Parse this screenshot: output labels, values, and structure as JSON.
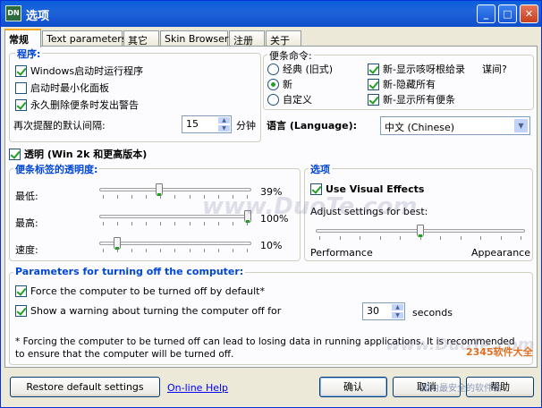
{
  "window": {
    "title": "选项",
    "icon_text": "DN"
  },
  "tabs": [
    {
      "label": "常规",
      "active": true
    },
    {
      "label": "Text parameters",
      "active": false
    },
    {
      "label": "其它",
      "active": false
    },
    {
      "label": "Skin Browser",
      "active": false
    },
    {
      "label": "注册",
      "active": false
    },
    {
      "label": "关于",
      "active": false
    }
  ],
  "program_group": {
    "legend": "程序:",
    "items": [
      {
        "label": "Windows启动时运行程序",
        "checked": true
      },
      {
        "label": "启动时最小化面板",
        "checked": false
      },
      {
        "label": "永久删除便条时发出警告",
        "checked": true
      }
    ],
    "reminder_label": "再次提醒的默认间隔:",
    "reminder_value": "15",
    "reminder_unit": "分钟"
  },
  "notes_cmd_group": {
    "legend": "便条命令:",
    "radios": [
      {
        "label": "经典 (旧式)",
        "checked": false
      },
      {
        "label": "新",
        "checked": true
      },
      {
        "label": "自定义",
        "checked": false
      }
    ],
    "checks": [
      {
        "label": "新-显示咳呀根给录",
        "checked": true
      },
      {
        "label": "新-隐藏所有",
        "checked": true
      },
      {
        "label": "新-显示所有便条",
        "checked": true
      }
    ],
    "query": "谋间?"
  },
  "language": {
    "label": "语言 (Language):",
    "value": "中文 (Chinese)"
  },
  "transparency": {
    "label": "透明 (Win 2k 和更高版本)",
    "checked": true,
    "legend": "便条标签的透明度:",
    "rows": [
      {
        "label": "最低:",
        "value": "39%",
        "level": 0.39
      },
      {
        "label": "最高:",
        "value": "100%",
        "level": 1.0
      },
      {
        "label": "速度:",
        "value": "10%",
        "level": 0.1
      }
    ]
  },
  "options_group": {
    "legend": "选项",
    "visual_effects": {
      "label": "Use Visual Effects",
      "checked": true
    },
    "adjust_label": "Adjust settings for best:",
    "left_label": "Performance",
    "right_label": "Appearance",
    "level": 0.5
  },
  "power_group": {
    "legend": "Parameters for turning off the computer:",
    "force": {
      "label": "Force the computer to be turned off by default*",
      "checked": true
    },
    "warn": {
      "label": "Show a warning about turning the computer off for",
      "checked": true
    },
    "warn_value": "30",
    "warn_unit": "seconds",
    "note": "* Forcing the computer to be turned off can lead to losing data in running applications. It is recommended to ensure that the computer will be turned off."
  },
  "footer": {
    "restore_label": "Restore default settings",
    "help_link": "On-line Help",
    "ok_label": "确认",
    "cancel_label": "取消",
    "help_label": "帮助"
  },
  "watermarks": {
    "center": "www.DuoTe.com",
    "bottom": "www.DuoTe.com",
    "brand": "2345软件大全",
    "brand_sub": "国内最安全的软件站"
  },
  "colors": {
    "accent": "#0046d5",
    "check": "#21a121",
    "titlebar": "#0a5fdc"
  }
}
